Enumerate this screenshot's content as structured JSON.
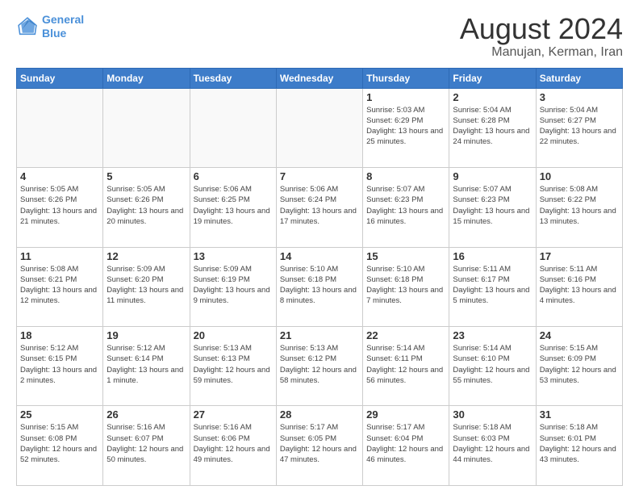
{
  "logo": {
    "line1": "General",
    "line2": "Blue"
  },
  "title": "August 2024",
  "subtitle": "Manujan, Kerman, Iran",
  "days_header": [
    "Sunday",
    "Monday",
    "Tuesday",
    "Wednesday",
    "Thursday",
    "Friday",
    "Saturday"
  ],
  "weeks": [
    [
      {
        "day": "",
        "info": ""
      },
      {
        "day": "",
        "info": ""
      },
      {
        "day": "",
        "info": ""
      },
      {
        "day": "",
        "info": ""
      },
      {
        "day": "1",
        "info": "Sunrise: 5:03 AM\nSunset: 6:29 PM\nDaylight: 13 hours and 25 minutes."
      },
      {
        "day": "2",
        "info": "Sunrise: 5:04 AM\nSunset: 6:28 PM\nDaylight: 13 hours and 24 minutes."
      },
      {
        "day": "3",
        "info": "Sunrise: 5:04 AM\nSunset: 6:27 PM\nDaylight: 13 hours and 22 minutes."
      }
    ],
    [
      {
        "day": "4",
        "info": "Sunrise: 5:05 AM\nSunset: 6:26 PM\nDaylight: 13 hours and 21 minutes."
      },
      {
        "day": "5",
        "info": "Sunrise: 5:05 AM\nSunset: 6:26 PM\nDaylight: 13 hours and 20 minutes."
      },
      {
        "day": "6",
        "info": "Sunrise: 5:06 AM\nSunset: 6:25 PM\nDaylight: 13 hours and 19 minutes."
      },
      {
        "day": "7",
        "info": "Sunrise: 5:06 AM\nSunset: 6:24 PM\nDaylight: 13 hours and 17 minutes."
      },
      {
        "day": "8",
        "info": "Sunrise: 5:07 AM\nSunset: 6:23 PM\nDaylight: 13 hours and 16 minutes."
      },
      {
        "day": "9",
        "info": "Sunrise: 5:07 AM\nSunset: 6:23 PM\nDaylight: 13 hours and 15 minutes."
      },
      {
        "day": "10",
        "info": "Sunrise: 5:08 AM\nSunset: 6:22 PM\nDaylight: 13 hours and 13 minutes."
      }
    ],
    [
      {
        "day": "11",
        "info": "Sunrise: 5:08 AM\nSunset: 6:21 PM\nDaylight: 13 hours and 12 minutes."
      },
      {
        "day": "12",
        "info": "Sunrise: 5:09 AM\nSunset: 6:20 PM\nDaylight: 13 hours and 11 minutes."
      },
      {
        "day": "13",
        "info": "Sunrise: 5:09 AM\nSunset: 6:19 PM\nDaylight: 13 hours and 9 minutes."
      },
      {
        "day": "14",
        "info": "Sunrise: 5:10 AM\nSunset: 6:18 PM\nDaylight: 13 hours and 8 minutes."
      },
      {
        "day": "15",
        "info": "Sunrise: 5:10 AM\nSunset: 6:18 PM\nDaylight: 13 hours and 7 minutes."
      },
      {
        "day": "16",
        "info": "Sunrise: 5:11 AM\nSunset: 6:17 PM\nDaylight: 13 hours and 5 minutes."
      },
      {
        "day": "17",
        "info": "Sunrise: 5:11 AM\nSunset: 6:16 PM\nDaylight: 13 hours and 4 minutes."
      }
    ],
    [
      {
        "day": "18",
        "info": "Sunrise: 5:12 AM\nSunset: 6:15 PM\nDaylight: 13 hours and 2 minutes."
      },
      {
        "day": "19",
        "info": "Sunrise: 5:12 AM\nSunset: 6:14 PM\nDaylight: 13 hours and 1 minute."
      },
      {
        "day": "20",
        "info": "Sunrise: 5:13 AM\nSunset: 6:13 PM\nDaylight: 12 hours and 59 minutes."
      },
      {
        "day": "21",
        "info": "Sunrise: 5:13 AM\nSunset: 6:12 PM\nDaylight: 12 hours and 58 minutes."
      },
      {
        "day": "22",
        "info": "Sunrise: 5:14 AM\nSunset: 6:11 PM\nDaylight: 12 hours and 56 minutes."
      },
      {
        "day": "23",
        "info": "Sunrise: 5:14 AM\nSunset: 6:10 PM\nDaylight: 12 hours and 55 minutes."
      },
      {
        "day": "24",
        "info": "Sunrise: 5:15 AM\nSunset: 6:09 PM\nDaylight: 12 hours and 53 minutes."
      }
    ],
    [
      {
        "day": "25",
        "info": "Sunrise: 5:15 AM\nSunset: 6:08 PM\nDaylight: 12 hours and 52 minutes."
      },
      {
        "day": "26",
        "info": "Sunrise: 5:16 AM\nSunset: 6:07 PM\nDaylight: 12 hours and 50 minutes."
      },
      {
        "day": "27",
        "info": "Sunrise: 5:16 AM\nSunset: 6:06 PM\nDaylight: 12 hours and 49 minutes."
      },
      {
        "day": "28",
        "info": "Sunrise: 5:17 AM\nSunset: 6:05 PM\nDaylight: 12 hours and 47 minutes."
      },
      {
        "day": "29",
        "info": "Sunrise: 5:17 AM\nSunset: 6:04 PM\nDaylight: 12 hours and 46 minutes."
      },
      {
        "day": "30",
        "info": "Sunrise: 5:18 AM\nSunset: 6:03 PM\nDaylight: 12 hours and 44 minutes."
      },
      {
        "day": "31",
        "info": "Sunrise: 5:18 AM\nSunset: 6:01 PM\nDaylight: 12 hours and 43 minutes."
      }
    ]
  ]
}
